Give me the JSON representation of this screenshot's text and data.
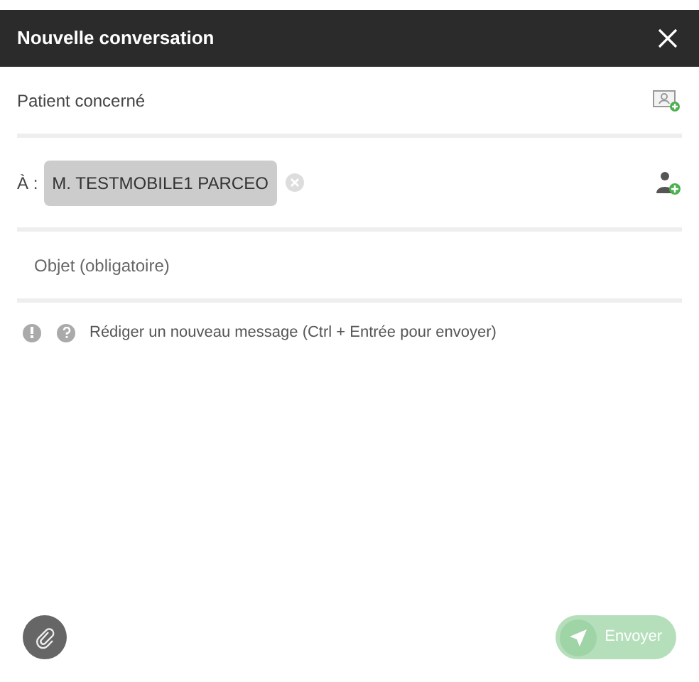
{
  "dialog": {
    "title": "Nouvelle conversation"
  },
  "patient": {
    "placeholder": "Patient concerné"
  },
  "recipients": {
    "label": "À :",
    "chips": [
      {
        "name": "M. TESTMOBILE1 PARCEO"
      }
    ]
  },
  "subject": {
    "placeholder": "Objet (obligatoire)"
  },
  "message": {
    "placeholder": "Rédiger un nouveau message (Ctrl + Entrée pour envoyer)"
  },
  "send_button": {
    "label": "Envoyer",
    "disabled": true
  }
}
